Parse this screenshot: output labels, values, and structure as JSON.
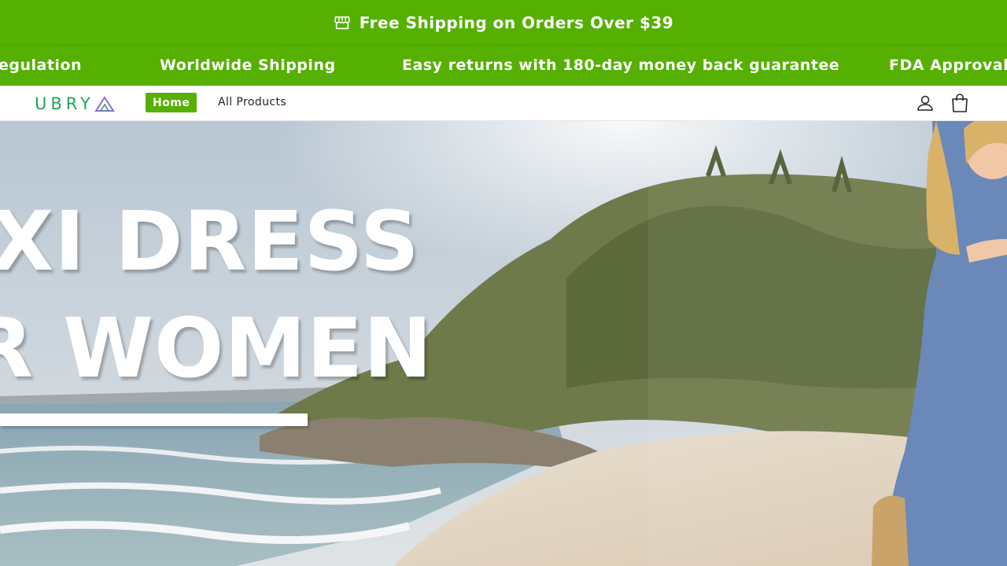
{
  "announcement": {
    "icon": "store-icon",
    "text": "Free Shipping on Orders Over $39"
  },
  "marquee": {
    "items": [
      "egulation",
      "Worldwide Shipping",
      "Easy returns with 180-day money back guarantee",
      "FDA Approval o"
    ]
  },
  "header": {
    "logo_text": "UBRY",
    "nav": {
      "home": "Home",
      "all_products": "All Products"
    },
    "icons": [
      "account-icon",
      "cart-icon"
    ]
  },
  "hero": {
    "line1": "XI DRESS",
    "line2": "R WOMEN"
  },
  "colors": {
    "accent": "#55b001",
    "logo": "#21a355"
  }
}
